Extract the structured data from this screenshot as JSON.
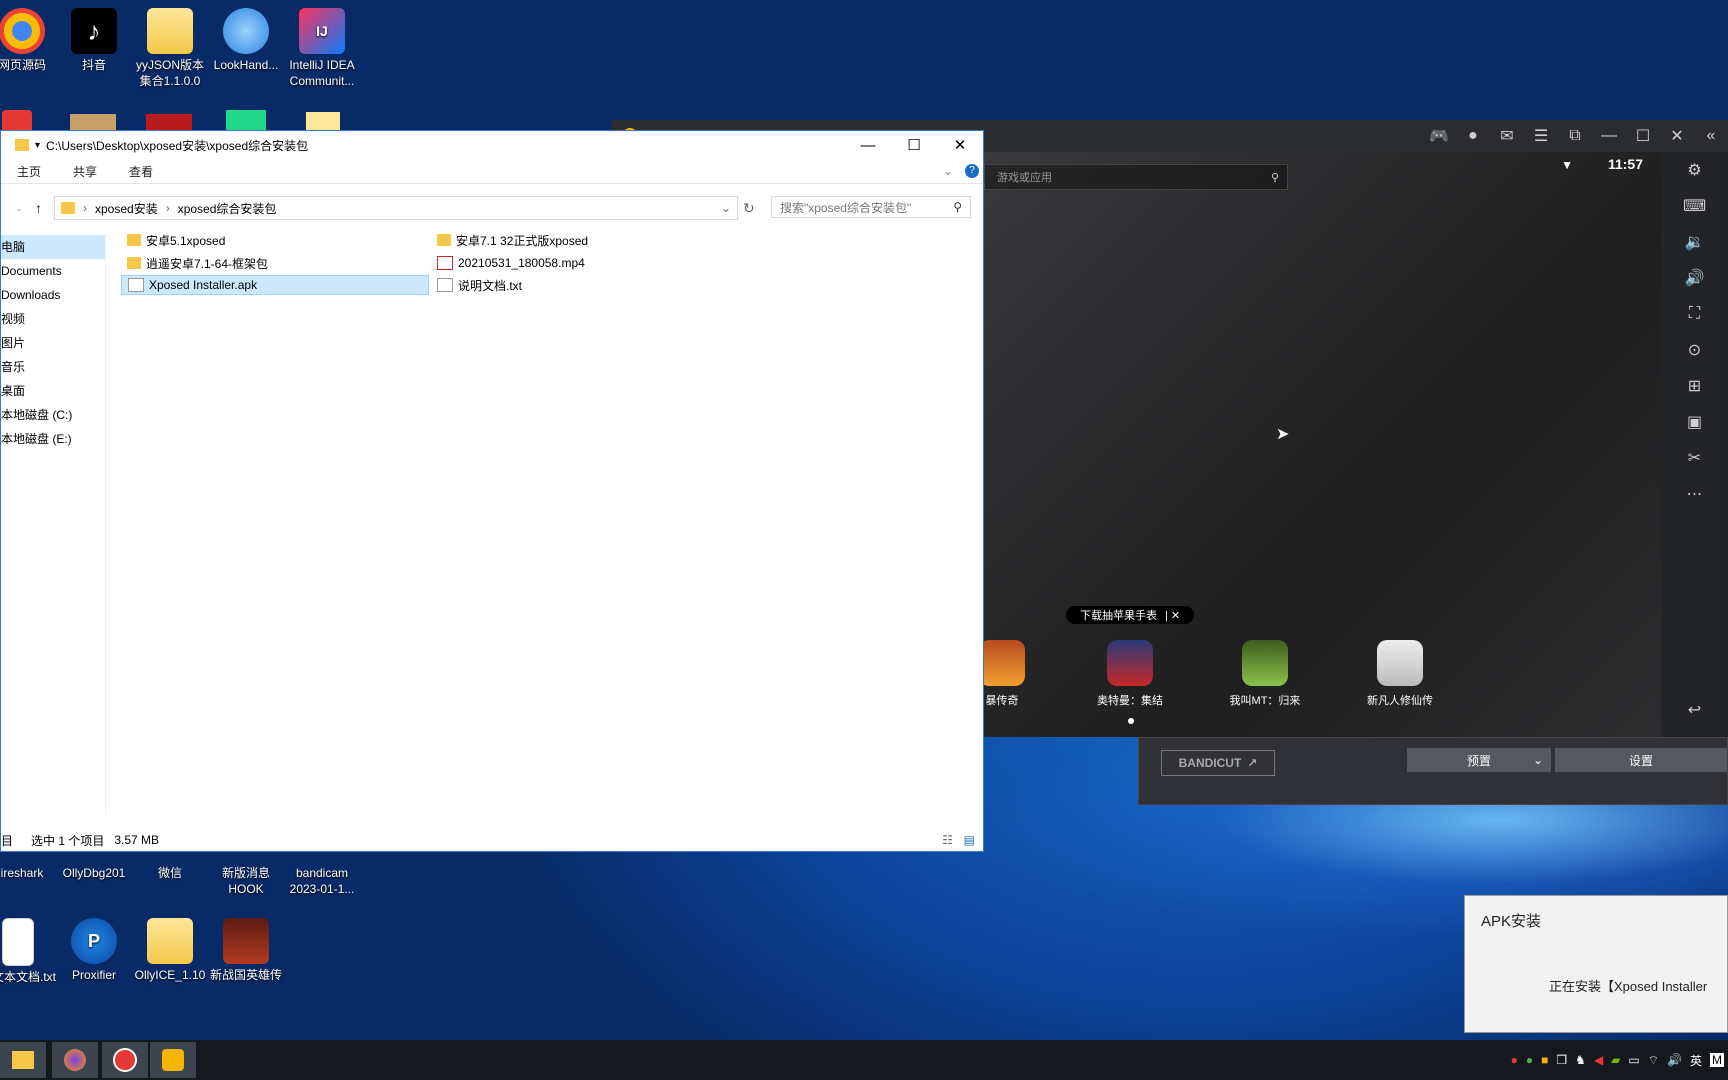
{
  "desktop": {
    "icons": [
      {
        "label": "网页源码",
        "icon": "chrome-icon"
      },
      {
        "label": "抖音",
        "icon": "tiktok-icon"
      },
      {
        "label": "yyJSON版本集合1.1.0.0",
        "icon": "folder-icon"
      },
      {
        "label": "LookHand...",
        "icon": "lookhandle-icon"
      },
      {
        "label": "IntelliJ IDEA Communit...",
        "icon": "intellij-icon"
      },
      {
        "label": "ireshark",
        "icon": "wireshark-icon"
      },
      {
        "label": "OllyDbg201",
        "icon": "ollydbg-icon"
      },
      {
        "label": "微信",
        "icon": "wechat-icon"
      },
      {
        "label": "新版消息HOOK",
        "icon": "app-icon"
      },
      {
        "label": "bandicam 2023-01-1...",
        "icon": "video-icon"
      },
      {
        "label": "建文本文档.txt",
        "icon": "text-file-icon"
      },
      {
        "label": "Proxifier",
        "icon": "proxifier-icon"
      },
      {
        "label": "OllyICE_1.10",
        "icon": "folder-icon"
      },
      {
        "label": "新战国英雄传",
        "icon": "game-icon"
      }
    ]
  },
  "explorer": {
    "title_path": "C:\\Users\\Desktop\\xposed安装\\xposed综合安装包",
    "ribbon_tabs": [
      "主页",
      "共享",
      "查看"
    ],
    "breadcrumb": [
      "xposed安装",
      "xposed综合安装包"
    ],
    "search_placeholder": "搜索\"xposed综合安装包\"",
    "nav": [
      "电脑",
      "Documents",
      "Downloads",
      "视频",
      "图片",
      "音乐",
      "桌面",
      "本地磁盘 (C:)",
      "本地磁盘 (E:)"
    ],
    "files": [
      {
        "name": "安卓5.1xposed",
        "type": "folder"
      },
      {
        "name": "逍遥安卓7.1-64-框架包",
        "type": "folder"
      },
      {
        "name": "Xposed Installer.apk",
        "type": "apk"
      },
      {
        "name": "安卓7.1 32正式版xposed",
        "type": "folder"
      },
      {
        "name": "20210531_180058.mp4",
        "type": "video"
      },
      {
        "name": "说明文档.txt",
        "type": "text"
      }
    ],
    "status_selected": "选中 1 个项目",
    "status_size": "3.57 MB",
    "status_left": "目"
  },
  "emulator": {
    "time": "11:57",
    "search_placeholder": "游戏或应用",
    "banner": "下载抽苹果手表",
    "apps": [
      "暴传奇",
      "奥特曼：集结",
      "我叫MT：归来",
      "新凡人修仙传"
    ]
  },
  "bandicam": {
    "logo": "BANDICUT",
    "preset_label": "预置",
    "settings_label": "设置"
  },
  "apk_toast": {
    "title": "APK安装",
    "message": "正在安装【Xposed Installer"
  },
  "taskbar": {
    "tray_lang": "英",
    "tray_m": "M"
  }
}
